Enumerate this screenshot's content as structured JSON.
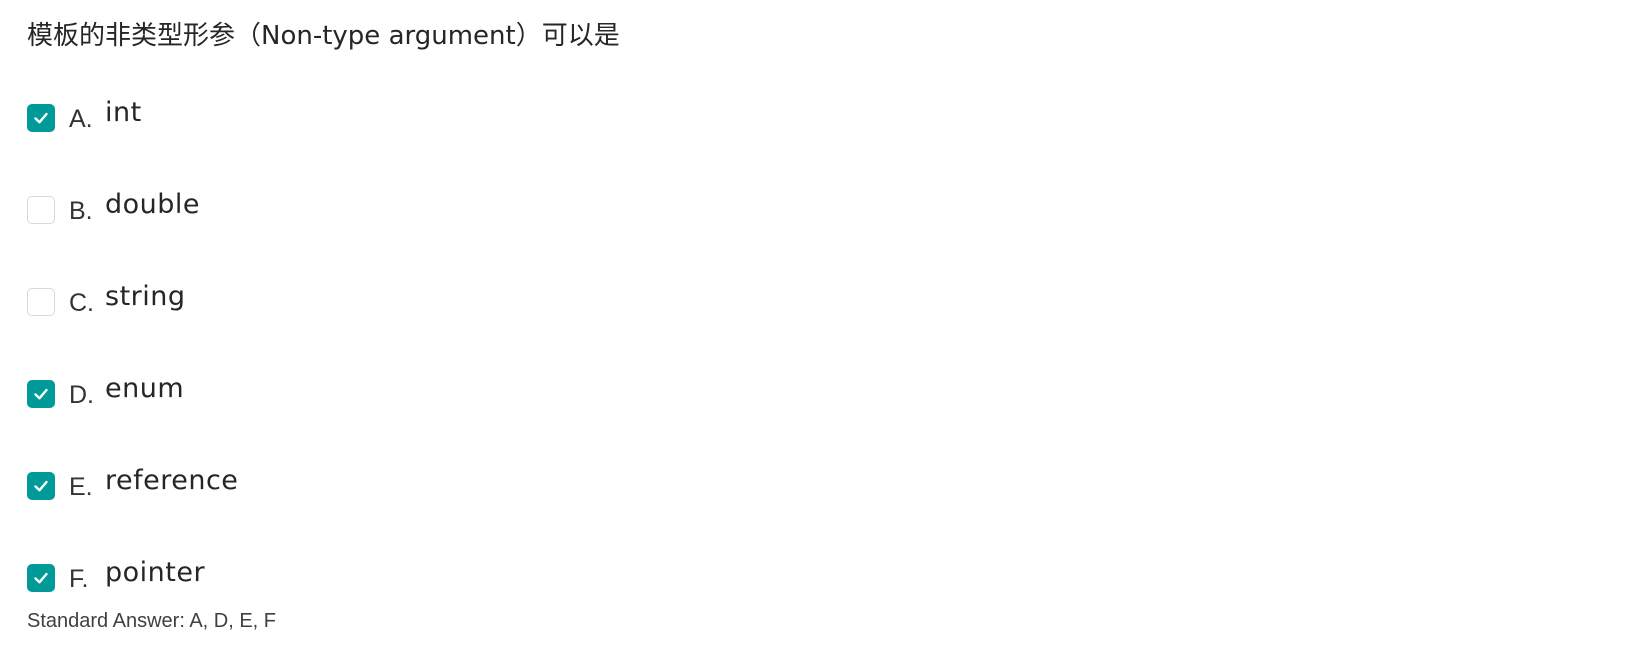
{
  "question": {
    "text": "模板的非类型形参（Non-type argument）可以是"
  },
  "options": [
    {
      "letter": "A.",
      "text": "int",
      "checked": true
    },
    {
      "letter": "B.",
      "text": "double",
      "checked": false
    },
    {
      "letter": "C.",
      "text": "string",
      "checked": false
    },
    {
      "letter": "D.",
      "text": "enum",
      "checked": true
    },
    {
      "letter": "E.",
      "text": "reference",
      "checked": true
    },
    {
      "letter": "F.",
      "text": "pointer",
      "checked": true
    }
  ],
  "answer": {
    "label": "Standard Answer: A, D, E, F"
  },
  "colors": {
    "accent": "#009a98",
    "checkbox_border": "#d9d9d9",
    "text": "#262626"
  },
  "icons": {
    "check": "check-icon"
  }
}
